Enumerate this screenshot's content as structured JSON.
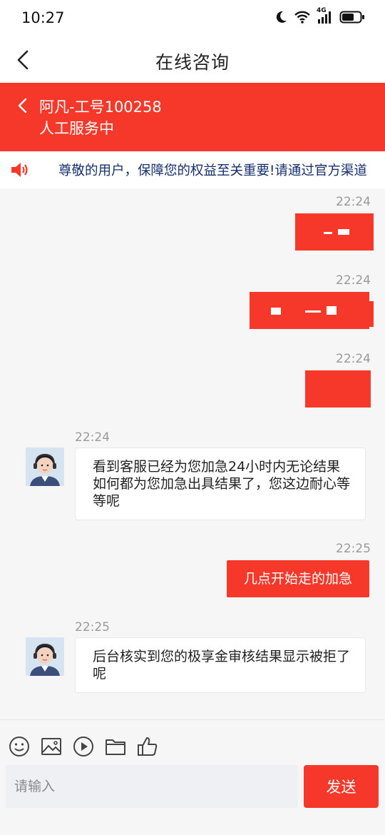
{
  "status_bar": {
    "time": "10:27",
    "network": "4G",
    "icons": [
      "moon-icon",
      "wifi-icon",
      "signal-icon",
      "battery-icon"
    ]
  },
  "nav": {
    "title": "在线咨询",
    "back_icon": "back-arrow-icon"
  },
  "agent": {
    "name": "阿凡-工号100258",
    "status": "人工服务中",
    "back_icon": "chevron-left-icon"
  },
  "notice": {
    "icon": "speaker-icon",
    "text": "尊敬的用户，保障您的权益至关重要!请通过官方渠道"
  },
  "messages": [
    {
      "side": "right",
      "time": "22:24",
      "type": "redacted"
    },
    {
      "side": "right",
      "time": "22:24",
      "type": "redacted"
    },
    {
      "side": "right",
      "time": "22:24",
      "type": "redacted"
    },
    {
      "side": "left",
      "time": "22:24",
      "type": "text",
      "text": "看到客服已经为您加急24小时内无论结果如何都为您加急出具结果了，您这边耐心等等呢"
    },
    {
      "side": "right",
      "time": "22:25",
      "type": "text",
      "text": "几点开始走的加急"
    },
    {
      "side": "left",
      "time": "22:25",
      "type": "text",
      "text": "后台核实到您的极享金审核结果显示被拒了呢"
    }
  ],
  "toolbar": {
    "icons": [
      "emoji-icon",
      "image-icon",
      "video-icon",
      "folder-icon",
      "thumbs-up-icon"
    ]
  },
  "input": {
    "placeholder": "请输入",
    "value": "",
    "send_label": "发送"
  },
  "colors": {
    "accent": "#f5382a",
    "notice_text": "#17306e",
    "background": "#f6f6f6"
  }
}
